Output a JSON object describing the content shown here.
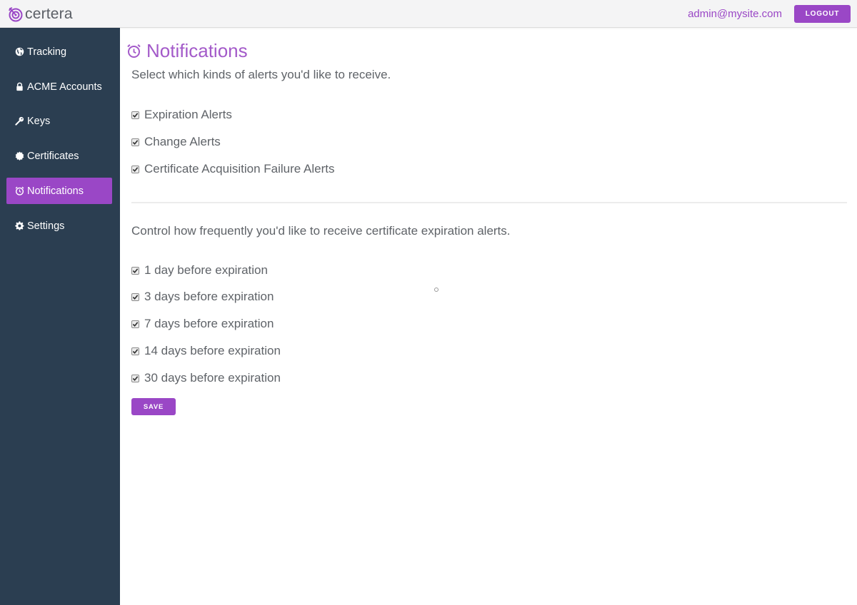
{
  "header": {
    "brand_name": "certera",
    "user_email": "admin@mysite.com",
    "logout_label": "LOGOUT",
    "accent_color": "#9a47c6"
  },
  "sidebar": {
    "background_color": "#2b3e51",
    "items": [
      {
        "label": "Tracking",
        "icon": "globe-icon",
        "active": false
      },
      {
        "label": "ACME Accounts",
        "icon": "lock-icon",
        "active": false
      },
      {
        "label": "Keys",
        "icon": "key-icon",
        "active": false
      },
      {
        "label": "Certificates",
        "icon": "certificate-icon",
        "active": false
      },
      {
        "label": "Notifications",
        "icon": "alarm-clock-icon",
        "active": true
      },
      {
        "label": "Settings",
        "icon": "gear-icon",
        "active": false
      }
    ]
  },
  "main": {
    "title": "Notifications",
    "title_icon": "alarm-clock-icon",
    "intro": "Select which kinds of alerts you'd like to receive.",
    "alert_types": [
      {
        "label": "Expiration Alerts",
        "checked": true
      },
      {
        "label": "Change Alerts",
        "checked": true
      },
      {
        "label": "Certificate Acquisition Failure Alerts",
        "checked": true
      }
    ],
    "frequency_intro": "Control how frequently you'd like to receive certificate expiration alerts.",
    "frequencies": [
      {
        "label": "1 day before expiration",
        "checked": true
      },
      {
        "label": "3 days before expiration",
        "checked": true
      },
      {
        "label": "7 days before expiration",
        "checked": true
      },
      {
        "label": "14 days before expiration",
        "checked": true
      },
      {
        "label": "30 days before expiration",
        "checked": true
      }
    ],
    "save_label": "SAVE"
  }
}
